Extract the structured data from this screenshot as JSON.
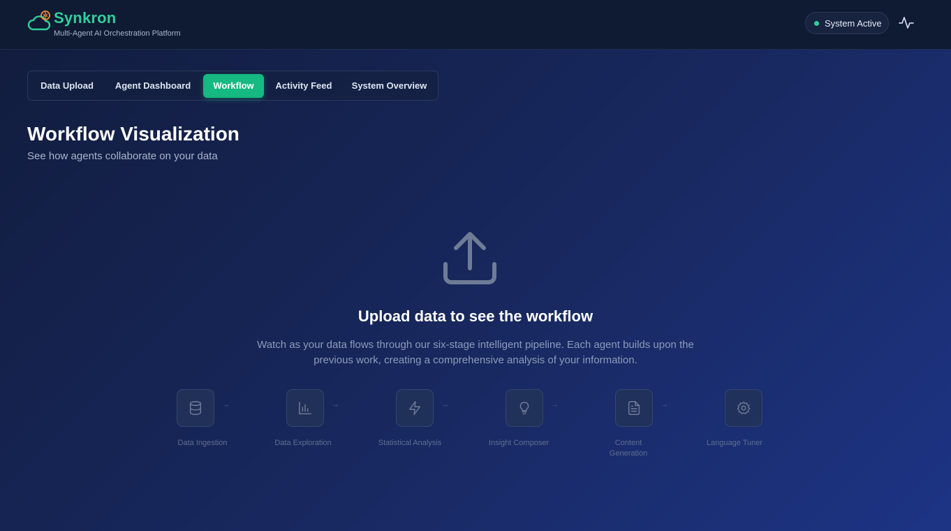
{
  "header": {
    "brand_name": "Synkron",
    "brand_subtitle": "Multi-Agent AI Orchestration Platform",
    "status_text": "System Active",
    "logo_icon": "cloud-brain-icon",
    "activity_icon": "pulse-icon"
  },
  "tabs": [
    {
      "label": "Data Upload",
      "active": false
    },
    {
      "label": "Agent Dashboard",
      "active": false
    },
    {
      "label": "Workflow",
      "active": true
    },
    {
      "label": "Activity Feed",
      "active": false
    },
    {
      "label": "System Overview",
      "active": false
    }
  ],
  "page": {
    "title": "Workflow Visualization",
    "subtitle": "See how agents collaborate on your data"
  },
  "empty_state": {
    "icon": "upload-icon",
    "title": "Upload data to see the workflow",
    "description": "Watch as your data flows through our six-stage intelligent pipeline. Each agent builds upon the previous work, creating a comprehensive analysis of your information."
  },
  "stages": [
    {
      "label": "Data Ingestion",
      "icon": "database-icon"
    },
    {
      "label": "Data Exploration",
      "icon": "bar-chart-icon"
    },
    {
      "label": "Statistical Analysis",
      "icon": "lightning-icon"
    },
    {
      "label": "Insight Composer",
      "icon": "lightbulb-icon"
    },
    {
      "label": "Content Generation",
      "icon": "document-icon"
    },
    {
      "label": "Language Tuner",
      "icon": "gear-icon"
    }
  ],
  "stage_arrow": "→",
  "colors": {
    "accent": "#15b981",
    "brand": "#2fcf9c",
    "logo_secondary": "#f08a3c",
    "header_bg": "#0f1a33"
  }
}
